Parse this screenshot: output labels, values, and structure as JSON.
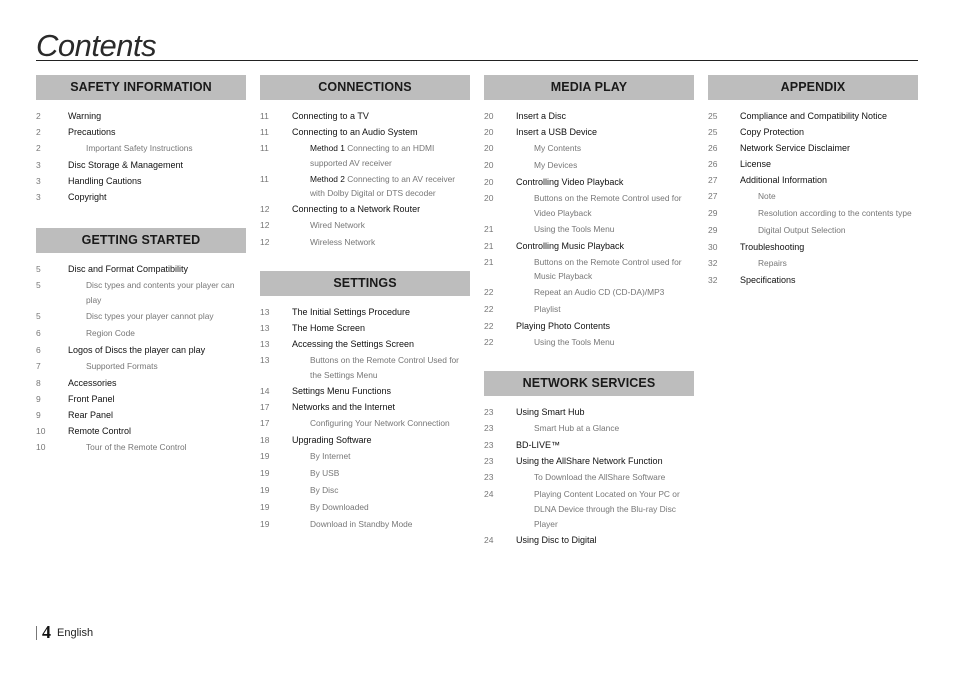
{
  "page": {
    "title": "Contents",
    "page_number": "4",
    "language": "English"
  },
  "columns": [
    {
      "sections": [
        {
          "heading": "SAFETY INFORMATION",
          "entries": [
            {
              "page": "2",
              "text": "Warning",
              "level": 1
            },
            {
              "page": "2",
              "text": "Precautions",
              "level": 1
            },
            {
              "page": "2",
              "text": "Important Safety Instructions",
              "level": 2
            },
            {
              "page": "3",
              "text": "Disc Storage & Management",
              "level": 1
            },
            {
              "page": "3",
              "text": "Handling Cautions",
              "level": 1
            },
            {
              "page": "3",
              "text": "Copyright",
              "level": 1
            }
          ]
        },
        {
          "heading": "GETTING STARTED",
          "entries": [
            {
              "page": "5",
              "text": "Disc and Format Compatibility",
              "level": 1
            },
            {
              "page": "5",
              "text": "Disc types and contents your player can play",
              "level": 2
            },
            {
              "page": "5",
              "text": "Disc types your player cannot play",
              "level": 2
            },
            {
              "page": "6",
              "text": "Region Code",
              "level": 2
            },
            {
              "page": "6",
              "text": "Logos of Discs the player can play",
              "level": 1
            },
            {
              "page": "7",
              "text": "Supported Formats",
              "level": 2
            },
            {
              "page": "8",
              "text": "Accessories",
              "level": 1
            },
            {
              "page": "9",
              "text": "Front Panel",
              "level": 1
            },
            {
              "page": "9",
              "text": "Rear Panel",
              "level": 1
            },
            {
              "page": "10",
              "text": "Remote Control",
              "level": 1
            },
            {
              "page": "10",
              "text": "Tour of the Remote Control",
              "level": 2
            }
          ]
        }
      ]
    },
    {
      "sections": [
        {
          "heading": "CONNECTIONS",
          "entries": [
            {
              "page": "11",
              "text": "Connecting to a TV",
              "level": 1
            },
            {
              "page": "11",
              "text": "Connecting to an Audio System",
              "level": 1
            },
            {
              "page": "11",
              "lead": "Method 1",
              "text": " Connecting to an HDMI supported AV receiver",
              "level": 2
            },
            {
              "page": "11",
              "lead": "Method 2",
              "text": " Connecting to an AV receiver with Dolby Digital or DTS decoder",
              "level": 2
            },
            {
              "page": "12",
              "text": "Connecting to a Network Router",
              "level": 1
            },
            {
              "page": "12",
              "text": "Wired Network",
              "level": 2
            },
            {
              "page": "12",
              "text": "Wireless Network",
              "level": 2
            }
          ]
        },
        {
          "heading": "SETTINGS",
          "entries": [
            {
              "page": "13",
              "text": "The Initial Settings Procedure",
              "level": 1
            },
            {
              "page": "13",
              "text": "The Home Screen",
              "level": 1
            },
            {
              "page": "13",
              "text": "Accessing the Settings Screen",
              "level": 1
            },
            {
              "page": "13",
              "text": "Buttons on the Remote Control Used for the Settings Menu",
              "level": 2
            },
            {
              "page": "14",
              "text": "Settings Menu Functions",
              "level": 1
            },
            {
              "page": "17",
              "text": "Networks and the Internet",
              "level": 1
            },
            {
              "page": "17",
              "text": "Configuring Your Network Connection",
              "level": 2
            },
            {
              "page": "18",
              "text": "Upgrading Software",
              "level": 1
            },
            {
              "page": "19",
              "text": "By Internet",
              "level": 2
            },
            {
              "page": "19",
              "text": "By USB",
              "level": 2
            },
            {
              "page": "19",
              "text": "By Disc",
              "level": 2
            },
            {
              "page": "19",
              "text": "By Downloaded",
              "level": 2
            },
            {
              "page": "19",
              "text": "Download in Standby Mode",
              "level": 2
            }
          ]
        }
      ]
    },
    {
      "sections": [
        {
          "heading": "MEDIA PLAY",
          "entries": [
            {
              "page": "20",
              "text": "Insert a Disc",
              "level": 1
            },
            {
              "page": "20",
              "text": "Insert a USB Device",
              "level": 1
            },
            {
              "page": "20",
              "text": "My Contents",
              "level": 2
            },
            {
              "page": "20",
              "text": "My Devices",
              "level": 2
            },
            {
              "page": "20",
              "text": "Controlling Video Playback",
              "level": 1
            },
            {
              "page": "20",
              "text": "Buttons on the Remote Control used for Video Playback",
              "level": 2
            },
            {
              "page": "21",
              "text": "Using the Tools Menu",
              "level": 2
            },
            {
              "page": "21",
              "text": "Controlling Music Playback",
              "level": 1
            },
            {
              "page": "21",
              "text": "Buttons on the Remote Control used for Music Playback",
              "level": 2
            },
            {
              "page": "22",
              "text": "Repeat an Audio CD (CD-DA)/MP3",
              "level": 2
            },
            {
              "page": "22",
              "text": "Playlist",
              "level": 2
            },
            {
              "page": "22",
              "text": "Playing Photo Contents",
              "level": 1
            },
            {
              "page": "22",
              "text": "Using the Tools Menu",
              "level": 2
            }
          ]
        },
        {
          "heading": "NETWORK SERVICES",
          "entries": [
            {
              "page": "23",
              "text": "Using Smart Hub",
              "level": 1
            },
            {
              "page": "23",
              "text": "Smart Hub at a Glance",
              "level": 2
            },
            {
              "page": "23",
              "text": "BD-LIVE™",
              "level": 1
            },
            {
              "page": "23",
              "text": "Using the AllShare Network Function",
              "level": 1
            },
            {
              "page": "23",
              "text": "To Download the AllShare Software",
              "level": 2
            },
            {
              "page": "24",
              "text": "Playing Content Located on Your PC or DLNA Device through the Blu-ray Disc Player",
              "level": 2
            },
            {
              "page": "24",
              "text": "Using Disc to Digital",
              "level": 1
            }
          ]
        }
      ]
    },
    {
      "sections": [
        {
          "heading": "APPENDIX",
          "entries": [
            {
              "page": "25",
              "text": "Compliance and Compatibility Notice",
              "level": 1
            },
            {
              "page": "25",
              "text": "Copy Protection",
              "level": 1
            },
            {
              "page": "26",
              "text": "Network Service Disclaimer",
              "level": 1
            },
            {
              "page": "26",
              "text": "License",
              "level": 1
            },
            {
              "page": "27",
              "text": "Additional Information",
              "level": 1
            },
            {
              "page": "27",
              "text": "Note",
              "level": 2
            },
            {
              "page": "29",
              "text": "Resolution according to the contents type",
              "level": 2
            },
            {
              "page": "29",
              "text": "Digital Output Selection",
              "level": 2
            },
            {
              "page": "30",
              "text": "Troubleshooting",
              "level": 1
            },
            {
              "page": "32",
              "text": "Repairs",
              "level": 2
            },
            {
              "page": "32",
              "text": "Specifications",
              "level": 1
            }
          ]
        }
      ]
    }
  ]
}
